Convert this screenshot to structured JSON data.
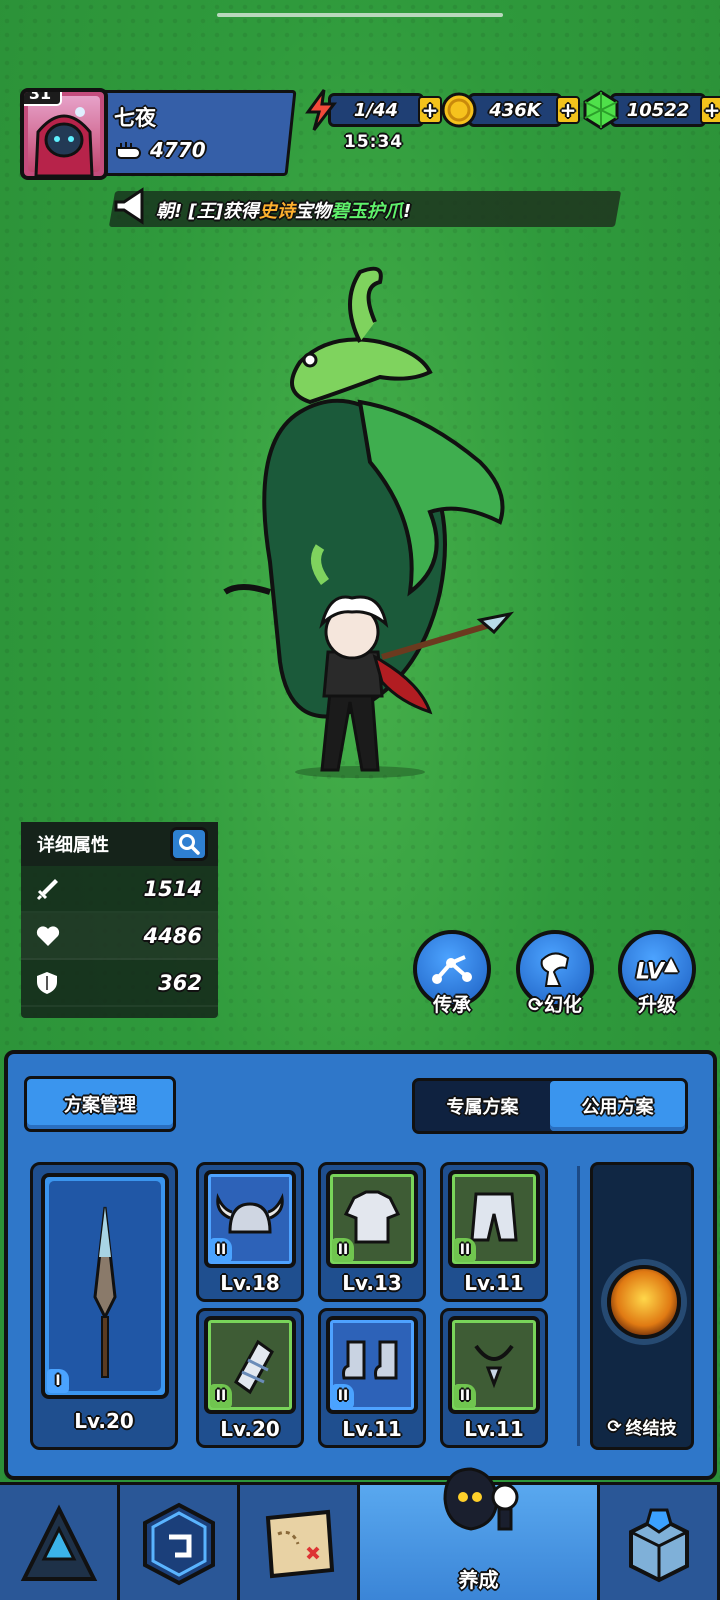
{
  "profile": {
    "level": "31",
    "name": "七夜",
    "power": "4770"
  },
  "resources": {
    "energy": "1/44",
    "energy_timer": "15:34",
    "gold": "436K",
    "gems": "10522",
    "plus": "+"
  },
  "broadcast": {
    "prefix": "朝! [王]获得",
    "rarity": "史诗",
    "middle": "宝物",
    "item": "碧玉护爪",
    "suffix": "!"
  },
  "stats": {
    "title": "详细属性",
    "attack": "1514",
    "hp": "4486",
    "defense": "362"
  },
  "actions": {
    "inherit": "传承",
    "transform": "幻化",
    "upgrade": "升级"
  },
  "plan": {
    "manage": "方案管理",
    "tab_exclusive": "专属方案",
    "tab_public": "公用方案",
    "active_tab": "公用方案"
  },
  "equipment": {
    "weapon": {
      "tier": "I",
      "level": "Lv.20"
    },
    "helmet": {
      "tier": "II",
      "level": "Lv.18"
    },
    "armor": {
      "tier": "II",
      "level": "Lv.13"
    },
    "pants": {
      "tier": "II",
      "level": "Lv.11"
    },
    "bracer": {
      "tier": "II",
      "level": "Lv.20"
    },
    "boots": {
      "tier": "II",
      "level": "Lv.11"
    },
    "necklace": {
      "tier": "II",
      "level": "Lv.11"
    }
  },
  "ultimate": {
    "label": "终结技"
  },
  "nav": {
    "active_label": "养成"
  },
  "colors": {
    "background": "#2f9a3c",
    "panel": "#2f77c9",
    "accent": "#3a95ee",
    "gold": "#f3c21b",
    "rarity_epic": "#ffb02e"
  }
}
